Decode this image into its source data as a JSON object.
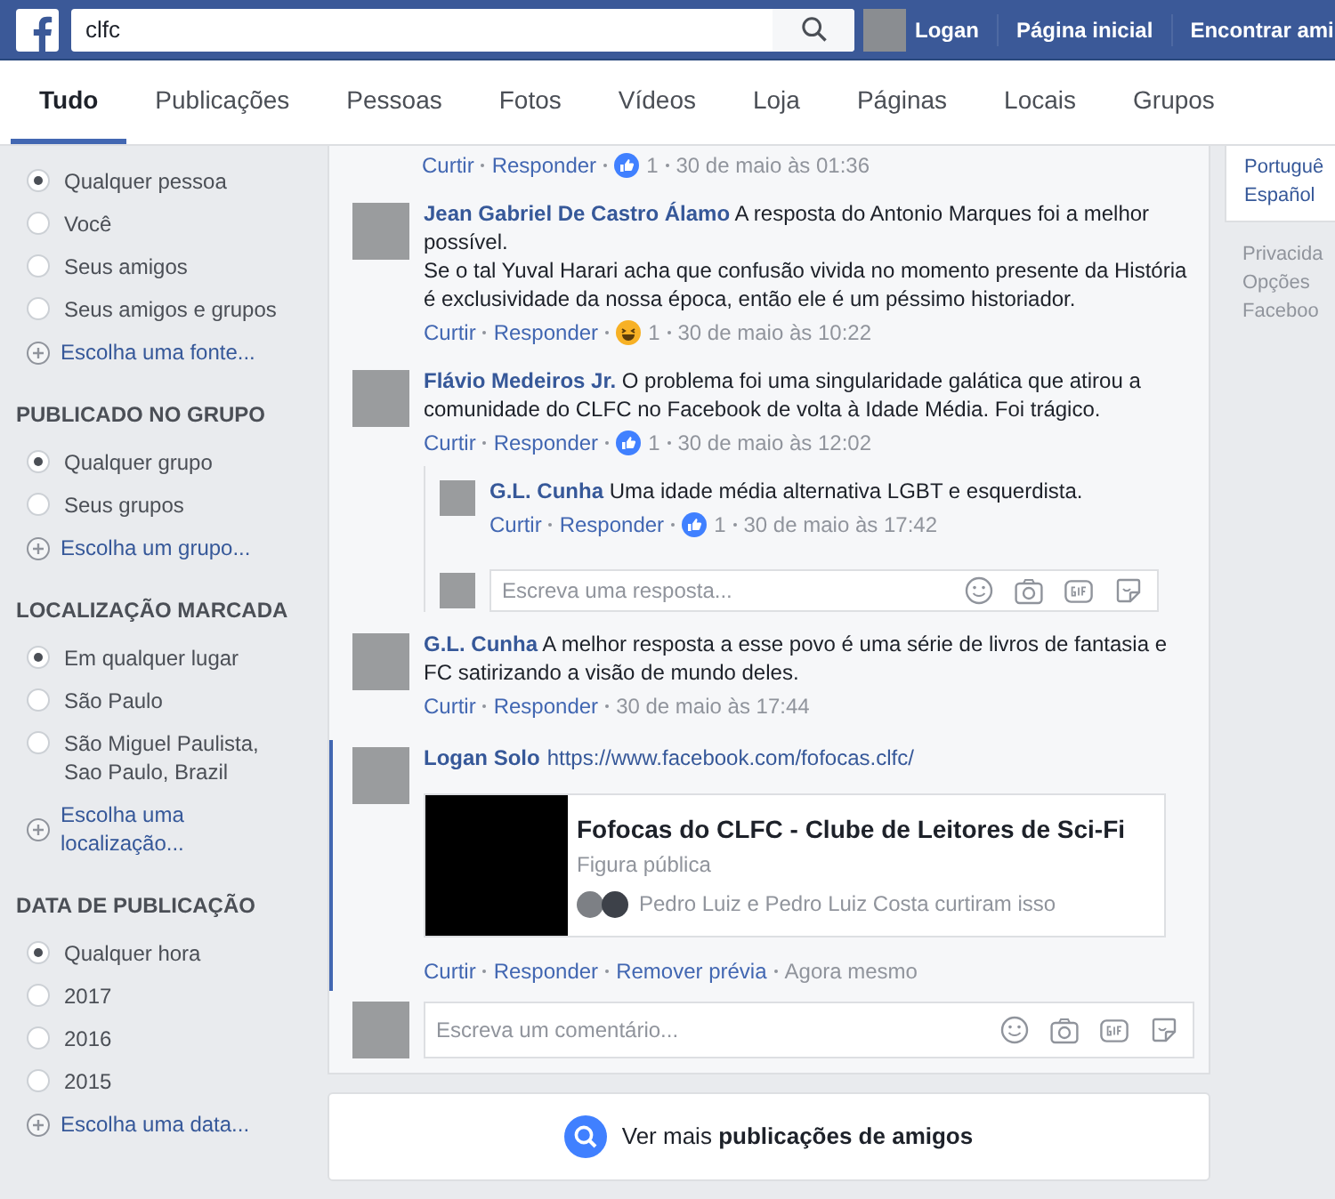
{
  "topbar": {
    "search": {
      "value": "clfc"
    },
    "user": "Logan",
    "links": [
      "Página inicial",
      "Encontrar ami"
    ]
  },
  "tabs": [
    {
      "label": "Tudo",
      "selected": true
    },
    {
      "label": "Publicações",
      "selected": false
    },
    {
      "label": "Pessoas",
      "selected": false
    },
    {
      "label": "Fotos",
      "selected": false
    },
    {
      "label": "Vídeos",
      "selected": false
    },
    {
      "label": "Loja",
      "selected": false
    },
    {
      "label": "Páginas",
      "selected": false
    },
    {
      "label": "Locais",
      "selected": false
    },
    {
      "label": "Grupos",
      "selected": false
    }
  ],
  "filters": [
    {
      "options": [
        {
          "label": "Qualquer pessoa",
          "selected": true
        },
        {
          "label": "Você",
          "selected": false
        },
        {
          "label": "Seus amigos",
          "selected": false
        },
        {
          "label": "Seus amigos e grupos",
          "selected": false
        }
      ],
      "add_link": "Escolha uma fonte..."
    },
    {
      "title": "PUBLICADO NO GRUPO",
      "options": [
        {
          "label": "Qualquer grupo",
          "selected": true
        },
        {
          "label": "Seus grupos",
          "selected": false
        }
      ],
      "add_link": "Escolha um grupo..."
    },
    {
      "title": "LOCALIZAÇÃO MARCADA",
      "options": [
        {
          "label": "Em qualquer lugar",
          "selected": true
        },
        {
          "label": "São Paulo",
          "selected": false
        },
        {
          "label": "São Miguel Paulista, Sao Paulo, Brazil",
          "selected": false
        }
      ],
      "add_link": "Escolha uma localização..."
    },
    {
      "title": "DATA DE PUBLICAÇÃO",
      "options": [
        {
          "label": "Qualquer hora",
          "selected": true
        },
        {
          "label": "2017",
          "selected": false
        },
        {
          "label": "2016",
          "selected": false
        },
        {
          "label": "2015",
          "selected": false
        }
      ],
      "add_link": "Escolha uma data..."
    }
  ],
  "first_actions": [
    {
      "kind": "link",
      "label": "Curtir"
    },
    {
      "kind": "link",
      "label": "Responder"
    },
    {
      "kind": "like",
      "count": "1"
    },
    {
      "kind": "time",
      "label": "30 de maio às 01:36"
    }
  ],
  "comments": [
    {
      "author": "Jean Gabriel De Castro Álamo",
      "text": [
        "A resposta do Antonio Marques foi a melhor possível.",
        "Se o tal Yuval Harari acha que confusão vivida no momento presente da História é exclusividade da nossa época, então ele é um péssimo historiador."
      ],
      "actions": [
        {
          "kind": "link",
          "label": "Curtir"
        },
        {
          "kind": "link",
          "label": "Responder"
        },
        {
          "kind": "haha",
          "count": "1"
        },
        {
          "kind": "time",
          "label": "30 de maio às 10:22"
        }
      ]
    },
    {
      "author": "Flávio Medeiros Jr.",
      "text": [
        "O problema foi uma singularidade galática que atirou a comunidade do CLFC no Facebook de volta à Idade Média. Foi trágico."
      ],
      "actions": [
        {
          "kind": "link",
          "label": "Curtir"
        },
        {
          "kind": "link",
          "label": "Responder"
        },
        {
          "kind": "like",
          "count": "1"
        },
        {
          "kind": "time",
          "label": "30 de maio às 12:02"
        }
      ],
      "children": [
        {
          "author": "G.L. Cunha",
          "text": [
            "Uma idade média alternativa LGBT e esquerdista."
          ],
          "actions": [
            {
              "kind": "link",
              "label": "Curtir"
            },
            {
              "kind": "link",
              "label": "Responder"
            },
            {
              "kind": "like",
              "count": "1"
            },
            {
              "kind": "time",
              "label": "30 de maio às 17:42"
            }
          ]
        }
      ],
      "reply_box": {
        "placeholder": "Escreva uma resposta..."
      }
    },
    {
      "author": "G.L. Cunha",
      "text": [
        "A melhor resposta a esse povo é uma série de livros de fantasia e FC satirizando a visão de mundo deles."
      ],
      "actions": [
        {
          "kind": "link",
          "label": "Curtir"
        },
        {
          "kind": "link",
          "label": "Responder"
        },
        {
          "kind": "time",
          "label": "30 de maio às 17:44"
        }
      ]
    },
    {
      "author": "Logan Solo",
      "highlighted": true,
      "link": "https://www.facebook.com/fofocas.clfc/",
      "preview": {
        "title": "Fofocas do CLFC - Clube de Leitores de Sci-Fi",
        "subtitle": "Figura pública",
        "likes": "Pedro Luiz e Pedro Luiz Costa curtiram isso"
      },
      "actions": [
        {
          "kind": "link",
          "label": "Curtir"
        },
        {
          "kind": "link",
          "label": "Responder"
        },
        {
          "kind": "link",
          "label": "Remover prévia"
        },
        {
          "kind": "time",
          "label": "Agora mesmo"
        }
      ]
    }
  ],
  "comment_box": {
    "placeholder": "Escreva um comentário..."
  },
  "more_button": "Ver mais **publicações de amigos**",
  "right_column": {
    "languages": [
      "Portuguê",
      "Español"
    ],
    "footer": [
      "Privacida",
      "Opções",
      "Faceboo"
    ]
  }
}
